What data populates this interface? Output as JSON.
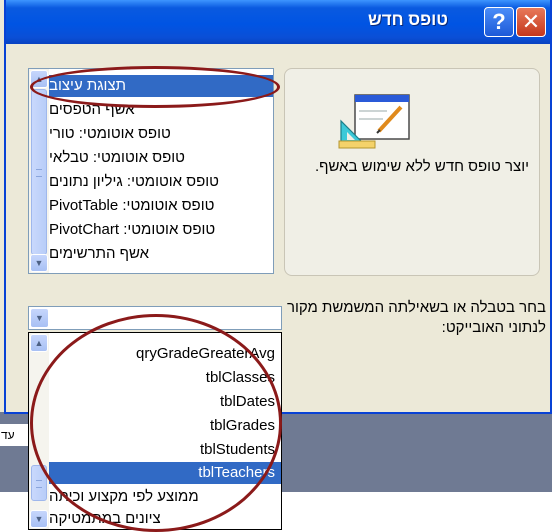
{
  "window": {
    "title": "טופס חדש",
    "help_label": "?",
    "close_label": "✕"
  },
  "preview": {
    "description": "יוצר טופס חדש ללא שימוש באשף."
  },
  "form_types": {
    "items": [
      "תצוגת עיצוב",
      "אשף הטפסים",
      "טופס אוטומטי: טורי",
      "טופס אוטומטי: טבלאי",
      "טופס אוטומטי: גיליון נתונים",
      "טופס אוטומטי: PivotTable",
      "טופס אוטומטי: PivotChart",
      "אשף התרשימים"
    ],
    "selected_index": 0
  },
  "source": {
    "label": "בחר בטבלה או בשאילתה המשמשת מקור לנתוני האובייקט:",
    "value": "",
    "options": [
      "qryGradeGreaterAvg",
      "tblClasses",
      "tblDates",
      "tblGrades",
      "tblStudents",
      "tblTeachers",
      "ממוצע לפי מקצוע וכיתה",
      "ציונים במתמטיקה"
    ],
    "selected_index": 5
  },
  "background_fragment": {
    "text": "עד"
  },
  "icons": {
    "preview": "form-design-icon",
    "scroll_up": "chevron-up-icon",
    "scroll_down": "chevron-down-icon"
  },
  "colors": {
    "titlebar": "#0054e3",
    "selection": "#316ac5",
    "annotation": "#8b1a1a",
    "dialog_bg": "#ece9d8"
  }
}
